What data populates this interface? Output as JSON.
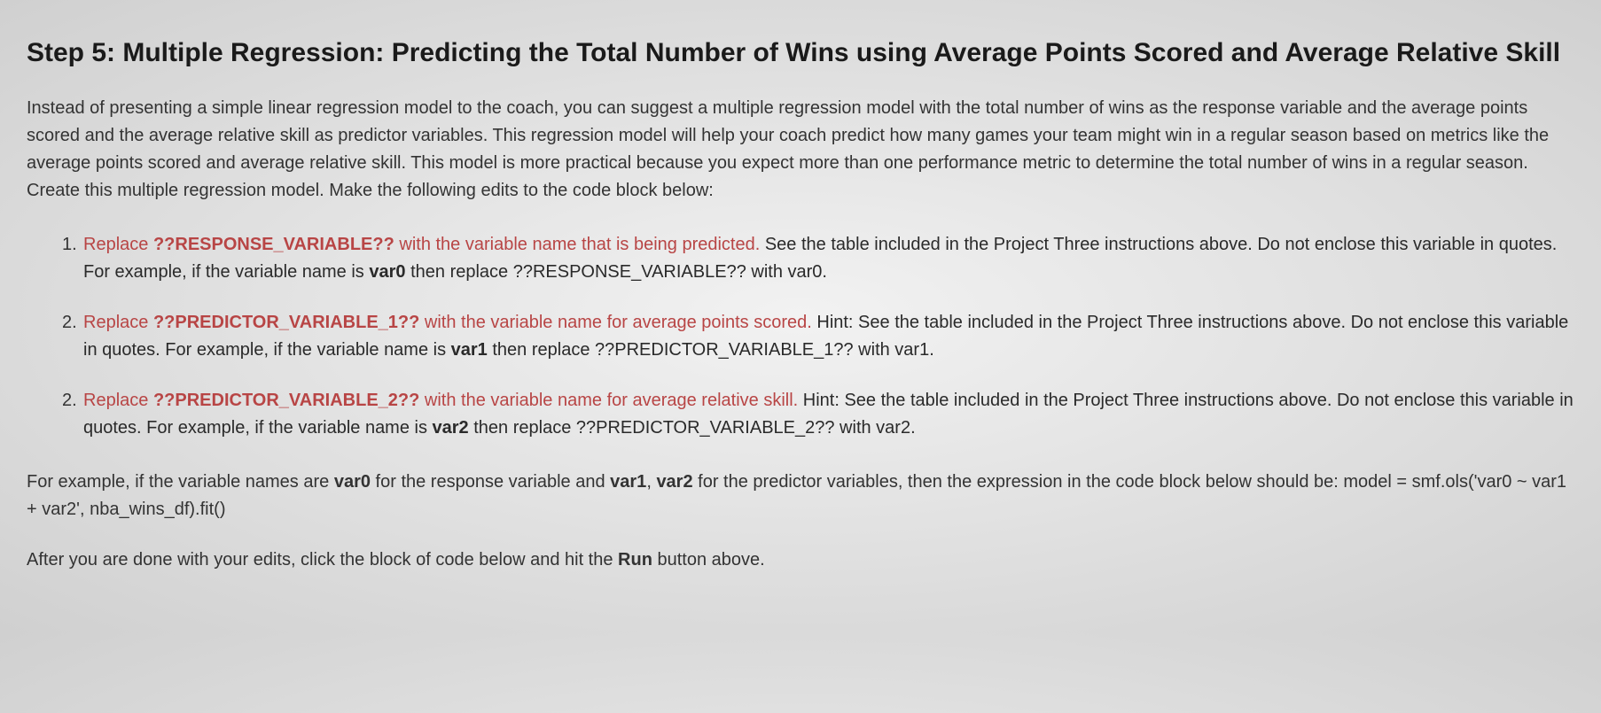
{
  "heading": "Step 5: Multiple Regression: Predicting the Total Number of Wins using Average Points Scored and Average Relative Skill",
  "intro": "Instead of presenting a simple linear regression model to the coach, you can suggest a multiple regression model with the total number of wins as the response variable and the average points scored and the average relative skill as predictor variables. This regression model will help your coach predict how many games your team might win in a regular season based on metrics like the average points scored and average relative skill. This model is more practical because you expect more than one performance metric to determine the total number of wins in a regular season. Create this multiple regression model. Make the following edits to the code block below:",
  "items": [
    {
      "num": "1.",
      "lead": "Replace ",
      "placeholder": "??RESPONSE_VARIABLE??",
      "mid": " with the variable name that is being predicted.",
      "rest1": " See the table included in the Project Three instructions above. Do not enclose this variable in quotes. For example, if the variable name is ",
      "var": "var0",
      "rest2": " then replace ??RESPONSE_VARIABLE?? with var0."
    },
    {
      "num": "2.",
      "lead": "Replace ",
      "placeholder": "??PREDICTOR_VARIABLE_1??",
      "mid": " with the variable name for average points scored.",
      "rest1": " Hint: See the table included in the Project Three instructions above. Do not enclose this variable in quotes. For example, if the variable name is ",
      "var": "var1",
      "rest2": " then replace ??PREDICTOR_VARIABLE_1?? with var1."
    },
    {
      "num": "2.",
      "lead": "Replace ",
      "placeholder": "??PREDICTOR_VARIABLE_2??",
      "mid": " with the variable name for average relative skill.",
      "rest1": " Hint: See the table included in the Project Three instructions above. Do not enclose this variable in quotes. For example, if the variable name is ",
      "var": "var2",
      "rest2": " then replace ??PREDICTOR_VARIABLE_2?? with var2."
    }
  ],
  "example": {
    "pre": "For example, if the variable names are ",
    "v0": "var0",
    "mid1": " for the response variable and ",
    "v1": "var1",
    "comma": ", ",
    "v2": "var2",
    "mid2": " for the predictor variables, then the expression in the code block below should be: model = smf.ols('var0 ~ var1 + var2', nba_wins_df).fit()"
  },
  "run": {
    "pre": "After you are done with your edits, click the block of code below and hit the ",
    "btn": "Run",
    "post": " button above."
  }
}
